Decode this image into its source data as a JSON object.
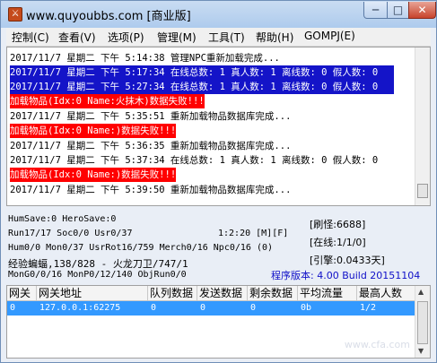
{
  "window": {
    "title": "www.quyoubbs.com [商业版]",
    "controls": {
      "minimize": "─",
      "maximize": "□",
      "close": "✕"
    }
  },
  "menu": [
    "控制(C)",
    "查看(V)",
    "选项(P)",
    "管理(M)",
    "工具(T)",
    "帮助(H)",
    "GOMPJ(E)"
  ],
  "log": [
    {
      "text": "2017/11/7 星期二 下午 5:14:38 管理NPC重新加载完成...",
      "style": "normal"
    },
    {
      "text": "2017/11/7 星期二 下午 5:17:34 在线总数: 1 真人数: 1 离线数: 0 假人数: 0",
      "style": "sel"
    },
    {
      "text": "2017/11/7 星期二 下午 5:27:34 在线总数: 1 真人数: 1 离线数: 0 假人数: 0",
      "style": "sel"
    },
    {
      "text": "加载物品(Idx:0 Name:火抹木)数据失败!!!",
      "style": "err"
    },
    {
      "text": "2017/11/7 星期二 下午 5:35:51 重新加载物品数据库完成...",
      "style": "normal"
    },
    {
      "text": "加载物品(Idx:0 Name:)数据失败!!!",
      "style": "err"
    },
    {
      "text": "2017/11/7 星期二 下午 5:36:35 重新加载物品数据库完成...",
      "style": "normal"
    },
    {
      "text": "2017/11/7 星期二 下午 5:37:34 在线总数: 1 真人数: 1 离线数: 0 假人数: 0",
      "style": "normal"
    },
    {
      "text": "加载物品(Idx:0 Name:)数据失败!!!",
      "style": "err"
    },
    {
      "text": "2017/11/7 星期二 下午 5:39:50 重新加载物品数据库完成...",
      "style": "normal"
    }
  ],
  "stats": {
    "line1": "HumSave:0 HeroSave:0",
    "line2": "Run17/17 Soc0/0 Usr0/37",
    "time": "1:2:20 [M][F]",
    "line3": "Hum0/0 Mon0/37 UsrRot16/759 Merch0/16 Npc0/16 (0)",
    "line4": "经验蝙蝠,138/828 - 火龙刀卫/747/1",
    "line5": "MonG0/0/16 MonP0/12/140 ObjRun0/0",
    "refresh": "[刷怪:6688]",
    "online": "[在线:1/1/0]",
    "engine": "[引擎:0.0433天]",
    "version": "程序版本: 4.00 Build 20151104"
  },
  "gateway": {
    "columns": [
      "网关",
      "网关地址",
      "队列数据",
      "发送数据",
      "剩余数据",
      "平均流量",
      "最高人数"
    ],
    "rows": [
      [
        "0",
        "127.0.0.1:62275",
        "0",
        "0",
        "0",
        "0b",
        "1/2"
      ]
    ]
  },
  "watermark": "www.cfa.com"
}
